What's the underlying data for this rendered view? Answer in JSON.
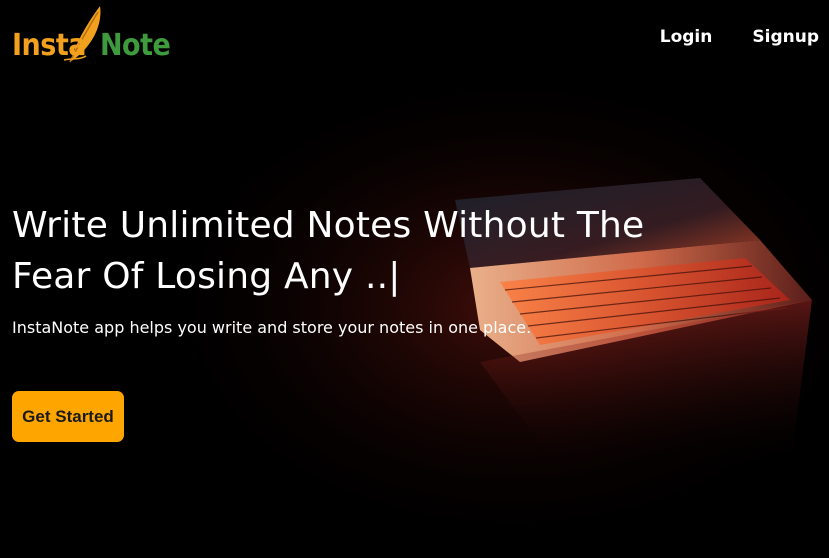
{
  "brand": {
    "logo_part1": "Insta",
    "logo_part2": "Note",
    "feather_icon": "feather-quill-icon",
    "colors": {
      "insta": "#f2a11e",
      "note": "#3d9a3d",
      "cta": "#ffa500"
    }
  },
  "nav": {
    "login_label": "Login",
    "signup_label": "Signup"
  },
  "hero": {
    "title": "Write Unlimited Notes Without The Fear Of Losing Any ..|",
    "subtitle": "InstaNote app helps you write and store your notes in one place.",
    "cta_label": "Get Started",
    "background_image": "laptop-glowing-keyboard"
  }
}
